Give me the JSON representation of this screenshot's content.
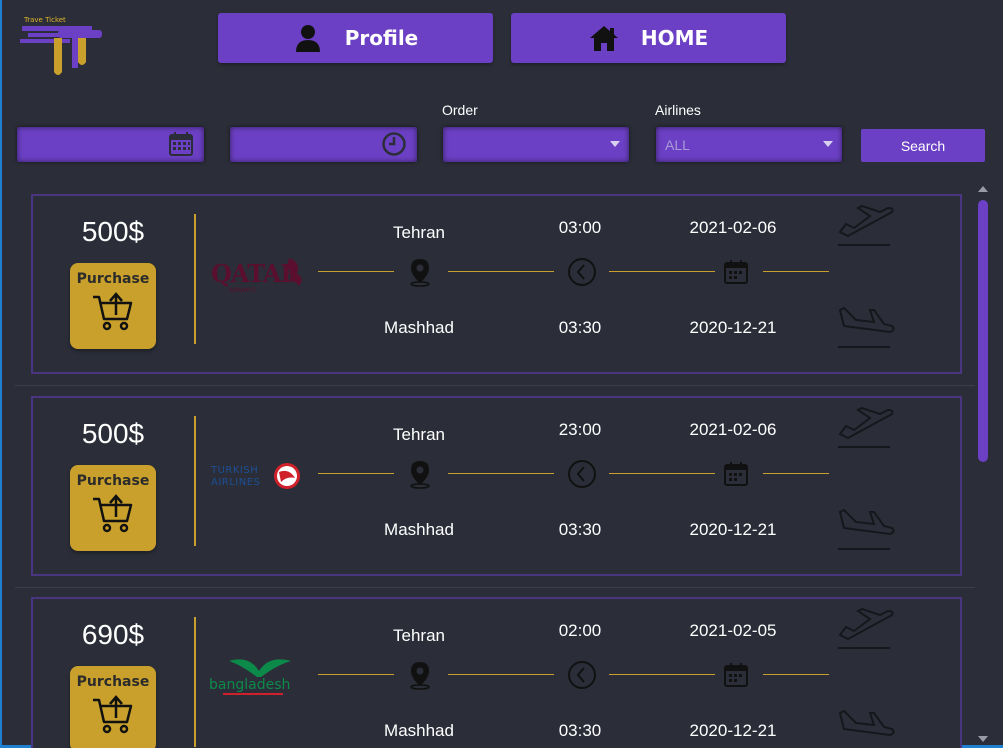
{
  "header": {
    "logo_text": "Trave Ticket",
    "profile_label": "Profile",
    "home_label": "HOME",
    "profile_icon": "user-icon",
    "home_icon": "house-icon"
  },
  "filters": {
    "date_value": "",
    "time_value": "",
    "order_label": "Order",
    "order_value": "",
    "airlines_label": "Airlines",
    "airlines_value": "ALL",
    "search_label": "Search"
  },
  "colors": {
    "accent": "#6b40c4",
    "gold": "#c9a02b",
    "background": "#2b2e38"
  },
  "flights": [
    {
      "price": "500$",
      "purchase_label": "Purchase",
      "airline": "Qatar Airways",
      "origin": "Tehran",
      "destination": "Mashhad",
      "depart_time": "03:00",
      "arrive_time": "03:30",
      "depart_date": "2021-02-06",
      "arrive_date": "2020-12-21"
    },
    {
      "price": "500$",
      "purchase_label": "Purchase",
      "airline": "Turkish Airlines",
      "origin": "Tehran",
      "destination": "Mashhad",
      "depart_time": "23:00",
      "arrive_time": "03:30",
      "depart_date": "2021-02-06",
      "arrive_date": "2020-12-21"
    },
    {
      "price": "690$",
      "purchase_label": "Purchase",
      "airline": "Biman Bangladesh",
      "origin": "Tehran",
      "destination": "Mashhad",
      "depart_time": "02:00",
      "arrive_time": "03:30",
      "depart_date": "2021-02-05",
      "arrive_date": "2020-12-21"
    }
  ]
}
